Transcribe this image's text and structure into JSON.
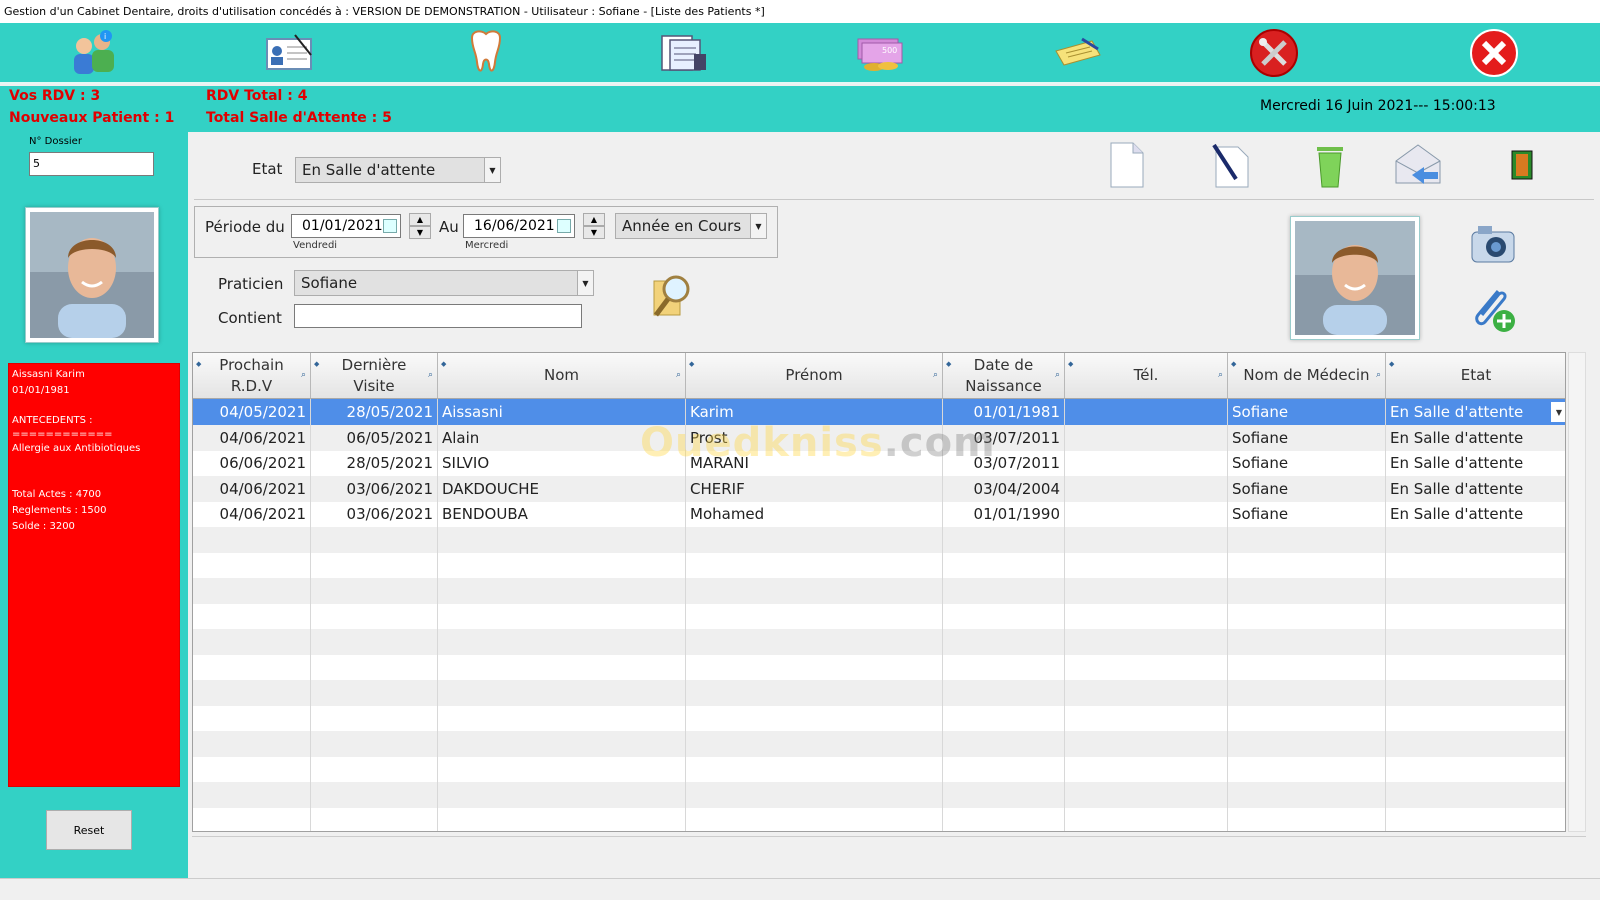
{
  "window": {
    "title": "Gestion d'un Cabinet Dentaire, droits d'utilisation concédés à : VERSION DE DEMONSTRATION - Utilisateur : Sofiane - [Liste des Patients *]"
  },
  "toolbar": {
    "icons": [
      "patients-group-icon",
      "patient-card-icon",
      "tooth-icon",
      "documents-icon",
      "money-icon",
      "payments-icon",
      "tools-icon",
      "close-app-icon"
    ]
  },
  "stats": {
    "vos_rdv": "Vos RDV : 3",
    "nouveaux_patient": "Nouveaux Patient : 1",
    "rdv_total": "RDV Total : 4",
    "total_salle": "Total Salle d'Attente : 5",
    "datetime": "Mercredi 16 Juin 2021--- 15:00:13"
  },
  "left": {
    "dossier_label": "N° Dossier",
    "dossier_value": "5",
    "info_lines": [
      "Aissasni Karim",
      "01/01/1981",
      "",
      "ANTECEDENTS :",
      "============",
      "Allergie aux Antibiotiques",
      "",
      "",
      "Total Actes : 4700",
      "Reglements  : 1500",
      "Solde : 3200"
    ],
    "reset_label": "Reset"
  },
  "filters": {
    "etat_label": "Etat",
    "etat_value": "En Salle d'attente",
    "periode_label": "Période du",
    "date_from": "01/01/2021",
    "date_from_day": "Vendredi",
    "au_label": "Au",
    "date_to": "16/06/2021",
    "date_to_day": "Mercredi",
    "range_value": "Année en Cours",
    "praticien_label": "Praticien",
    "praticien_value": "Sofiane",
    "contient_label": "Contient",
    "contient_value": ""
  },
  "grid": {
    "headers": [
      {
        "l1": "Prochain",
        "l2": "R.D.V"
      },
      {
        "l1": "Dernière",
        "l2": "Visite"
      },
      {
        "l1": "Nom",
        "l2": ""
      },
      {
        "l1": "Prénom",
        "l2": ""
      },
      {
        "l1": "Date de",
        "l2": "Naissance"
      },
      {
        "l1": "Tél.",
        "l2": ""
      },
      {
        "l1": "Nom de Médecin",
        "l2": ""
      },
      {
        "l1": "Etat",
        "l2": ""
      }
    ],
    "rows": [
      [
        "04/05/2021",
        "28/05/2021",
        "Aissasni",
        "Karim",
        "01/01/1981",
        "",
        "Sofiane",
        "En Salle d'attente"
      ],
      [
        "04/06/2021",
        "06/05/2021",
        "Alain",
        "Prost",
        "03/07/2011",
        "",
        "Sofiane",
        "En Salle d'attente"
      ],
      [
        "06/06/2021",
        "28/05/2021",
        "SILVIO",
        "MARANI",
        "03/07/2011",
        "",
        "Sofiane",
        "En Salle d'attente"
      ],
      [
        "04/06/2021",
        "03/06/2021",
        "DAKDOUCHE",
        "CHERIF",
        "03/04/2004",
        "",
        "Sofiane",
        "En Salle d'attente"
      ],
      [
        "04/06/2021",
        "03/06/2021",
        "BENDOUBA",
        "Mohamed",
        "01/01/1990",
        "",
        "Sofiane",
        "En Salle d'attente"
      ]
    ],
    "selected_row": 0
  },
  "watermark": {
    "part1": "Ouedkniss",
    "part2": ".com"
  }
}
